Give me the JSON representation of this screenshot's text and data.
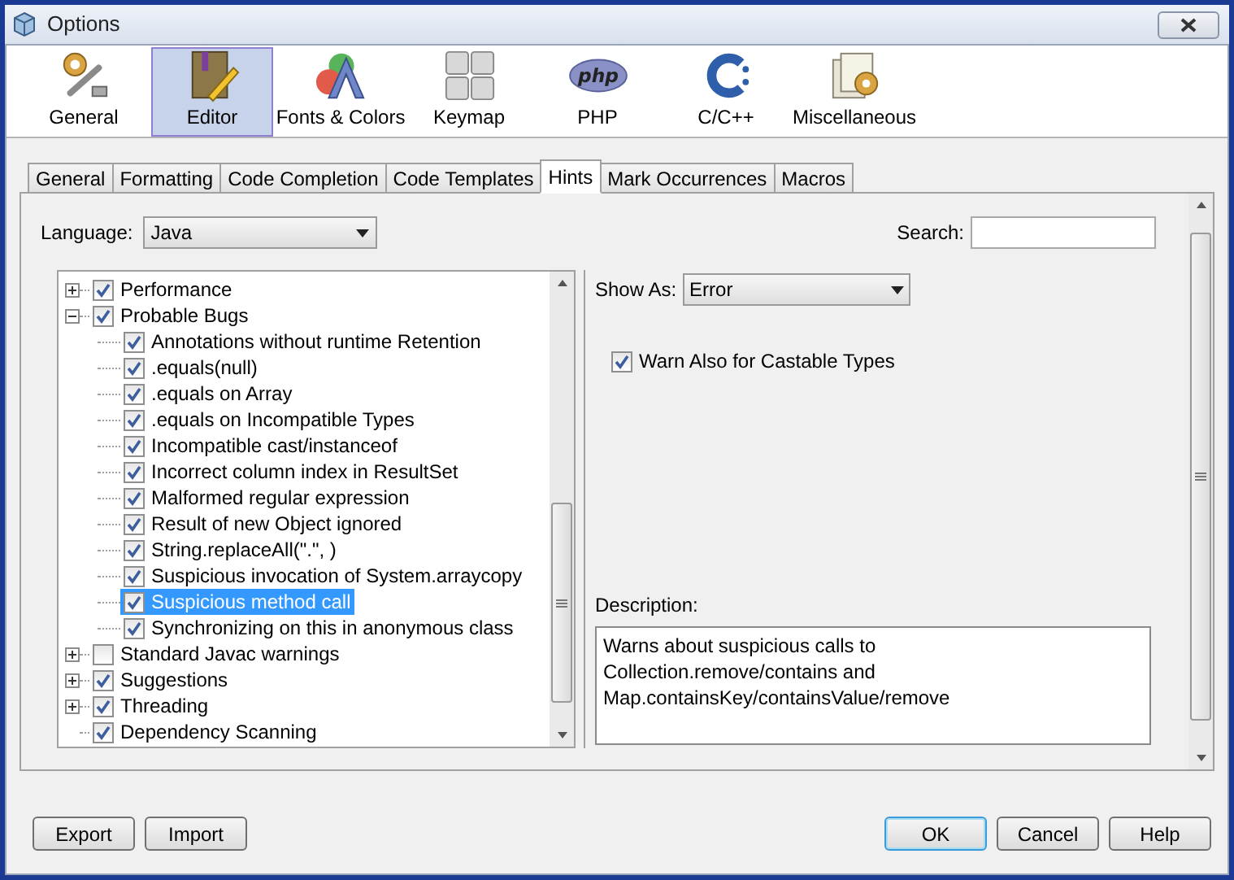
{
  "window": {
    "title": "Options"
  },
  "categories": [
    {
      "label": "General",
      "selected": false
    },
    {
      "label": "Editor",
      "selected": true
    },
    {
      "label": "Fonts & Colors",
      "selected": false
    },
    {
      "label": "Keymap",
      "selected": false
    },
    {
      "label": "PHP",
      "selected": false,
      "logo_text": "php"
    },
    {
      "label": "C/C++",
      "selected": false
    },
    {
      "label": "Miscellaneous",
      "selected": false
    }
  ],
  "tabs": [
    {
      "label": "General",
      "selected": false
    },
    {
      "label": "Formatting",
      "selected": false
    },
    {
      "label": "Code Completion",
      "selected": false
    },
    {
      "label": "Code Templates",
      "selected": false
    },
    {
      "label": "Hints",
      "selected": true
    },
    {
      "label": "Mark Occurrences",
      "selected": false
    },
    {
      "label": "Macros",
      "selected": false
    }
  ],
  "language": {
    "label": "Language:",
    "value": "Java"
  },
  "search": {
    "label": "Search:"
  },
  "tree": [
    {
      "label": "Performance",
      "checked": true,
      "expanded": false,
      "selected": false
    },
    {
      "label": "Probable Bugs",
      "checked": true,
      "expanded": true,
      "selected": false,
      "children": [
        {
          "label": "Annotations without runtime Retention",
          "checked": true,
          "selected": false
        },
        {
          "label": ".equals(null)",
          "checked": true,
          "selected": false
        },
        {
          "label": ".equals on Array",
          "checked": true,
          "selected": false
        },
        {
          "label": ".equals on Incompatible Types",
          "checked": true,
          "selected": false
        },
        {
          "label": "Incompatible cast/instanceof",
          "checked": true,
          "selected": false
        },
        {
          "label": "Incorrect column index in ResultSet",
          "checked": true,
          "selected": false
        },
        {
          "label": "Malformed regular expression",
          "checked": true,
          "selected": false
        },
        {
          "label": "Result of new Object ignored",
          "checked": true,
          "selected": false
        },
        {
          "label": "String.replaceAll(\".\", )",
          "checked": true,
          "selected": false
        },
        {
          "label": "Suspicious invocation of System.arraycopy",
          "checked": true,
          "selected": false
        },
        {
          "label": "Suspicious method call",
          "checked": true,
          "selected": true
        },
        {
          "label": "Synchronizing on this in anonymous class",
          "checked": true,
          "selected": false
        }
      ]
    },
    {
      "label": "Standard Javac warnings",
      "checked": false,
      "expanded": false,
      "selected": false
    },
    {
      "label": "Suggestions",
      "checked": true,
      "expanded": false,
      "selected": false
    },
    {
      "label": "Threading",
      "checked": true,
      "expanded": false,
      "selected": false
    },
    {
      "label": "Dependency Scanning",
      "checked": true,
      "selected": false
    }
  ],
  "show_as": {
    "label": "Show As:",
    "value": "Error"
  },
  "option": {
    "label": "Warn Also for Castable Types",
    "checked": true
  },
  "description": {
    "label": "Description:",
    "text": "Warns about suspicious calls to\nCollection.remove/contains and\nMap.containsKey/containsValue/remove"
  },
  "buttons_left": [
    {
      "label": "Export",
      "default": false
    },
    {
      "label": "Import",
      "default": false
    }
  ],
  "buttons_right": [
    {
      "label": "OK",
      "default": true
    },
    {
      "label": "Cancel",
      "default": false
    },
    {
      "label": "Help",
      "default": false
    }
  ]
}
